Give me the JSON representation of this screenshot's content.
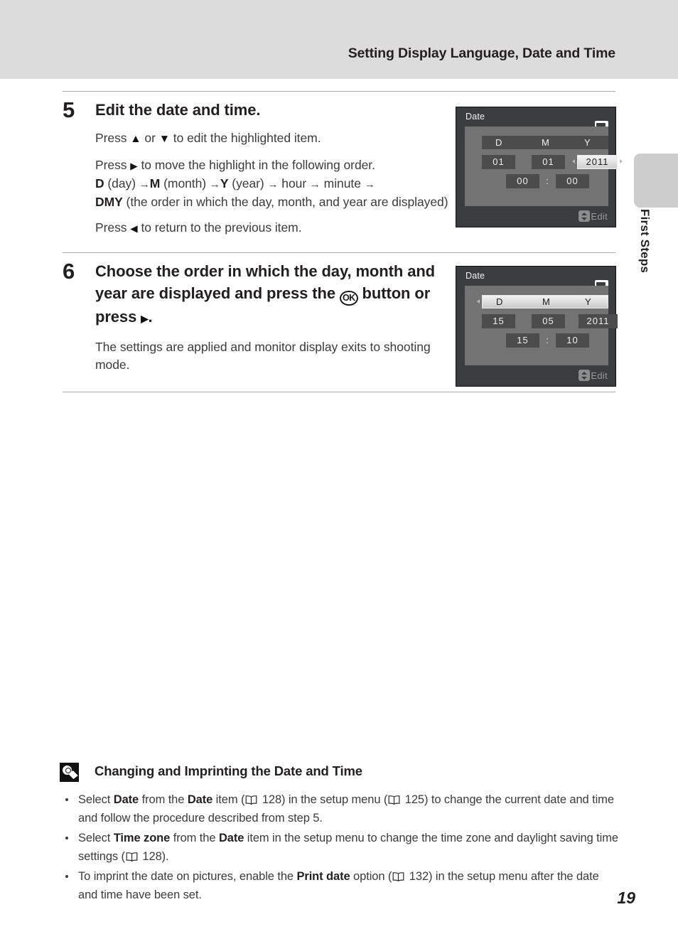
{
  "header": {
    "title": "Setting Display Language, Date and Time"
  },
  "side_tab": {
    "label": "First Steps"
  },
  "steps": [
    {
      "number": "5",
      "heading": "Edit the date and time.",
      "para1_pre": "Press ",
      "para1_post": " to edit the highlighted item.",
      "para1_or": " or ",
      "para2_line1_pre": "Press ",
      "para2_line1_post": " to move the highlight in the following order.",
      "para2_line2_a": "D",
      "para2_line2_b": " (day) ",
      "para2_line2_c": "M",
      "para2_line2_d": " (month) ",
      "para2_line2_e": "Y",
      "para2_line2_f": " (year) ",
      "para2_line2_g": " hour ",
      "para2_line2_h": " minute ",
      "para2_line3_a": "DMY",
      "para2_line3_b": " (the order in which the day, month, and year are displayed)",
      "para3_pre": "Press ",
      "para3_post": " to return to the previous item."
    },
    {
      "number": "6",
      "heading_a": "Choose the order in which the day, month and year are displayed and press the ",
      "heading_ok": "OK",
      "heading_b": " button or press ",
      "heading_c": ".",
      "para1": "The settings are applied and monitor display exits to shooting mode."
    }
  ],
  "monitors": [
    {
      "title": "Date",
      "dmy_labels": {
        "d": "D",
        "m": "M",
        "y": "Y"
      },
      "day": "01",
      "month": "01",
      "year": "2011",
      "hour": "00",
      "colon": ":",
      "minute": "00",
      "footer_label": "Edit",
      "selected": "year"
    },
    {
      "title": "Date",
      "dmy_labels": {
        "d": "D",
        "m": "M",
        "y": "Y"
      },
      "day": "15",
      "month": "05",
      "year": "2011",
      "hour": "15",
      "colon": ":",
      "minute": "10",
      "footer_label": "Edit",
      "selected": "dmy-row"
    }
  ],
  "note": {
    "title": "Changing and Imprinting the Date and Time",
    "items": [
      {
        "parts": [
          {
            "t": "Select "
          },
          {
            "t": "Date",
            "b": true
          },
          {
            "t": " from the "
          },
          {
            "t": "Date",
            "b": true
          },
          {
            "t": " item ("
          },
          {
            "icon": "book"
          },
          {
            "t": " 128) in the setup menu ("
          },
          {
            "icon": "book"
          },
          {
            "t": " 125) to change the current date and time and follow the procedure described from step 5."
          }
        ]
      },
      {
        "parts": [
          {
            "t": "Select "
          },
          {
            "t": "Time zone",
            "b": true
          },
          {
            "t": " from the "
          },
          {
            "t": "Date",
            "b": true
          },
          {
            "t": " item in the setup menu to change the time zone and daylight saving time settings ("
          },
          {
            "icon": "book"
          },
          {
            "t": " 128)."
          }
        ]
      },
      {
        "parts": [
          {
            "t": "To imprint the date on pictures, enable the "
          },
          {
            "t": "Print date",
            "b": true
          },
          {
            "t": " option ("
          },
          {
            "icon": "book"
          },
          {
            "t": " 132) in the setup menu after the date and time have been set."
          }
        ]
      }
    ]
  },
  "page_number": "19",
  "colors": {
    "header_band": "#dcdcdc",
    "side_tab": "#cdcdcd",
    "monitor_chrome": "#3b3c3f",
    "monitor_field": "#737373",
    "cell": "#4c4c4c",
    "selected_cell": "#e8e8e8",
    "text": "#231f20",
    "body_text": "#3b3b3b"
  }
}
